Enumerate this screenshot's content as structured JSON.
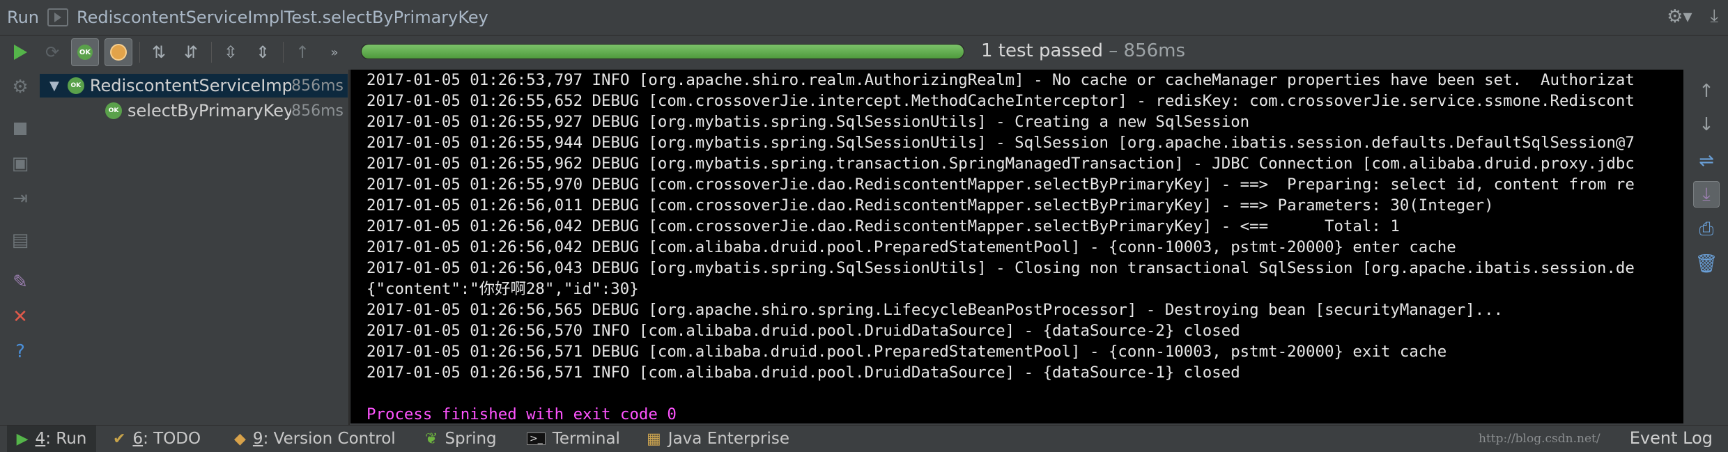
{
  "title_bar": {
    "run_label": "Run",
    "config_name": "RediscontentServiceImplTest.selectByPrimaryKey",
    "right_icons": [
      "gear-icon",
      "hide-icon"
    ]
  },
  "toolbar": {
    "buttons": [
      "rerun-icon",
      "rerun-failed-icon",
      "show-passed-icon",
      "show-ignored-icon",
      "sort-alpha-icon",
      "sort-duration-icon",
      "expand-all-icon",
      "collapse-all-icon",
      "prev-failed-icon",
      "more-icon"
    ],
    "progress": 1.0,
    "status_text": "1 test passed",
    "status_time": " – 856ms"
  },
  "tree": {
    "root": {
      "badge": "OK",
      "name": "RediscontentServiceImp",
      "duration": "856ms"
    },
    "child": {
      "badge": "OK",
      "name": "selectByPrimaryKey",
      "duration": "856ms"
    }
  },
  "console": {
    "lines": [
      "2017-01-05 01:26:53,797 INFO [org.apache.shiro.realm.AuthorizingRealm] - No cache or cacheManager properties have been set.  Authorizat",
      "2017-01-05 01:26:55,652 DEBUG [com.crossoverJie.intercept.MethodCacheInterceptor] - redisKey: com.crossoverJie.service.ssmone.Rediscont",
      "2017-01-05 01:26:55,927 DEBUG [org.mybatis.spring.SqlSessionUtils] - Creating a new SqlSession",
      "2017-01-05 01:26:55,944 DEBUG [org.mybatis.spring.SqlSessionUtils] - SqlSession [org.apache.ibatis.session.defaults.DefaultSqlSession@7",
      "2017-01-05 01:26:55,962 DEBUG [org.mybatis.spring.transaction.SpringManagedTransaction] - JDBC Connection [com.alibaba.druid.proxy.jdbc",
      "2017-01-05 01:26:55,970 DEBUG [com.crossoverJie.dao.RediscontentMapper.selectByPrimaryKey] - ==>  Preparing: select id, content from re",
      "2017-01-05 01:26:56,011 DEBUG [com.crossoverJie.dao.RediscontentMapper.selectByPrimaryKey] - ==> Parameters: 30(Integer)",
      "2017-01-05 01:26:56,042 DEBUG [com.crossoverJie.dao.RediscontentMapper.selectByPrimaryKey] - <==      Total: 1",
      "2017-01-05 01:26:56,042 DEBUG [com.alibaba.druid.pool.PreparedStatementPool] - {conn-10003, pstmt-20000} enter cache",
      "2017-01-05 01:26:56,043 DEBUG [org.mybatis.spring.SqlSessionUtils] - Closing non transactional SqlSession [org.apache.ibatis.session.de",
      "{\"content\":\"你好啊28\",\"id\":30}",
      "2017-01-05 01:26:56,565 DEBUG [org.apache.shiro.spring.LifecycleBeanPostProcessor] - Destroying bean [securityManager]...",
      "2017-01-05 01:26:56,570 INFO [com.alibaba.druid.pool.DruidDataSource] - {dataSource-2} closed",
      "2017-01-05 01:26:56,571 DEBUG [com.alibaba.druid.pool.PreparedStatementPool] - {conn-10003, pstmt-20000} exit cache",
      "2017-01-05 01:26:56,571 INFO [com.alibaba.druid.pool.DruidDataSource] - {dataSource-1} closed",
      "",
      "Process finished with exit code 0"
    ]
  },
  "bottom_tabs": [
    {
      "num": "4",
      "label": ": Run",
      "icon": "run-icon"
    },
    {
      "num": "6",
      "label": ": TODO",
      "icon": "todo-icon"
    },
    {
      "num": "9",
      "label": ": Version Control",
      "icon": "vcs-icon"
    },
    {
      "num": "",
      "label": "Spring",
      "icon": "spring-icon"
    },
    {
      "num": "",
      "label": "Terminal",
      "icon": "terminal-icon"
    },
    {
      "num": "",
      "label": "Java Enterprise",
      "icon": "java-enterprise-icon"
    }
  ],
  "event_log": "Event Log",
  "watermark": "http://blog.csdn.net/"
}
